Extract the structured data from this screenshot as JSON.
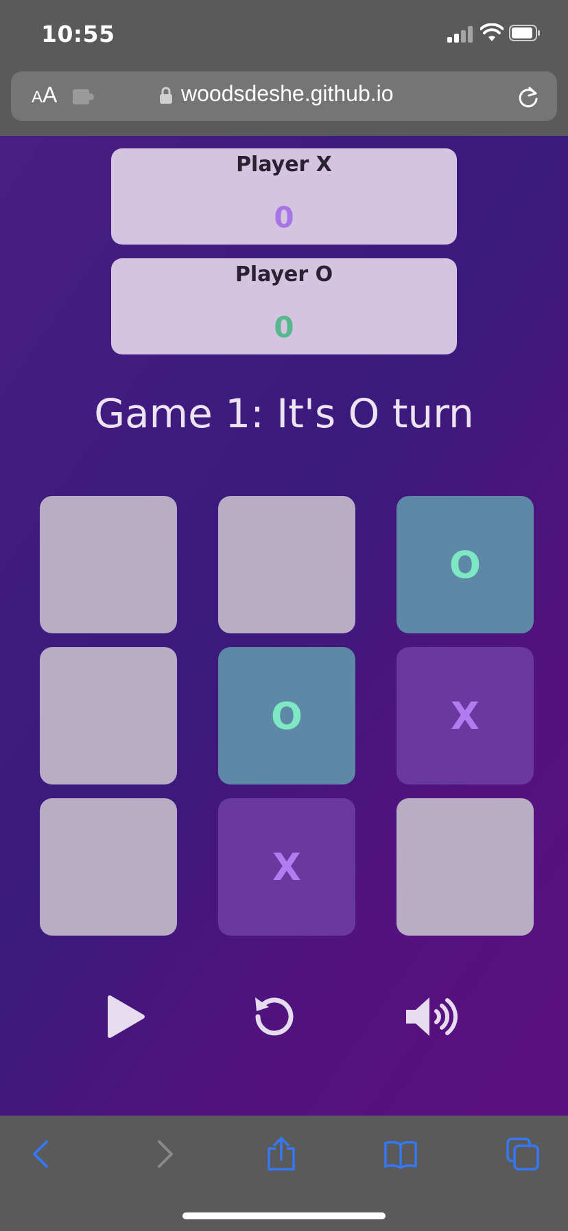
{
  "status_bar": {
    "time": "10:55",
    "icons": [
      "cellular-signal-icon",
      "wifi-icon",
      "battery-icon"
    ]
  },
  "browser": {
    "reader_label_small": "A",
    "reader_label_big": "A",
    "url": "woodsdeshe.github.io",
    "icons": [
      "puzzle-extension-icon",
      "lock-icon",
      "reload-icon"
    ]
  },
  "scores": {
    "x": {
      "label": "Player X",
      "value": "0"
    },
    "o": {
      "label": "Player O",
      "value": "0"
    }
  },
  "game": {
    "status": "Game 1: It's O turn",
    "board": [
      {
        "mark": "",
        "state": "empty"
      },
      {
        "mark": "",
        "state": "empty"
      },
      {
        "mark": "O",
        "state": "o"
      },
      {
        "mark": "",
        "state": "empty"
      },
      {
        "mark": "O",
        "state": "o"
      },
      {
        "mark": "X",
        "state": "x"
      },
      {
        "mark": "",
        "state": "empty"
      },
      {
        "mark": "X",
        "state": "x"
      },
      {
        "mark": "",
        "state": "empty"
      }
    ]
  },
  "controls": [
    "play-icon",
    "restart-icon",
    "sound-icon"
  ],
  "browser_nav": [
    "back-icon",
    "forward-icon",
    "share-icon",
    "bookmarks-icon",
    "tabs-icon"
  ],
  "colors": {
    "page_gradient": [
      "#4a1d84",
      "#5c1080"
    ],
    "x_mark": "#b27cf0",
    "o_mark": "#7ee8c5",
    "x_score": "#a874e6",
    "o_score": "#57b88f",
    "ios_blue": "#3478f6"
  }
}
